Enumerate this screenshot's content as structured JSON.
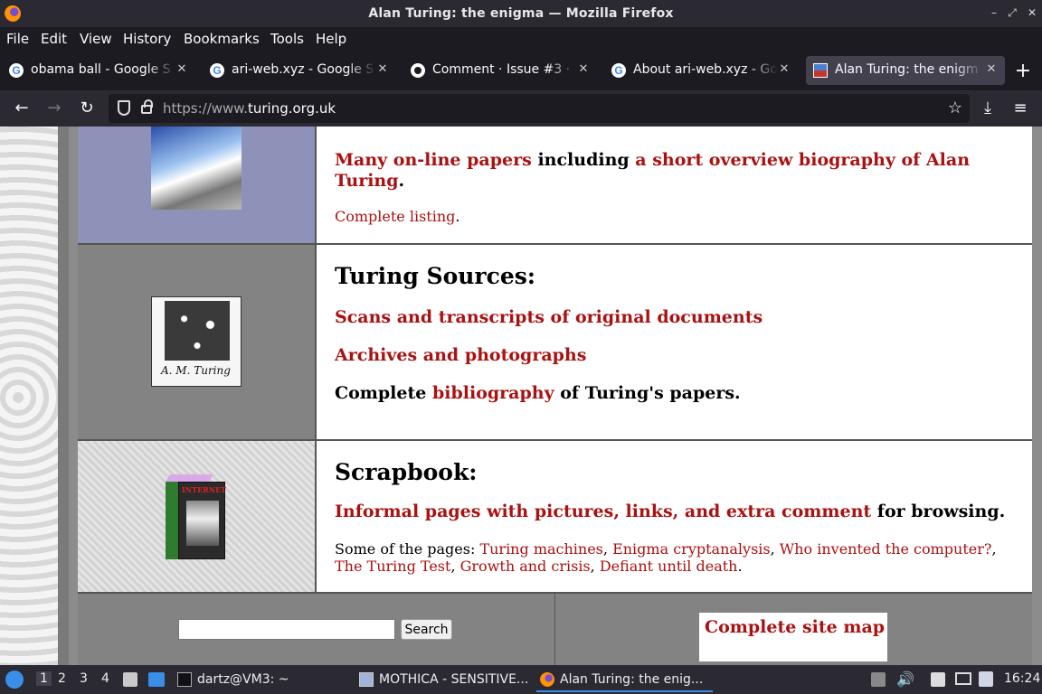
{
  "window": {
    "title": "Alan Turing: the enigma — Mozilla Firefox"
  },
  "menu": [
    "File",
    "Edit",
    "View",
    "History",
    "Bookmarks",
    "Tools",
    "Help"
  ],
  "tabs": [
    {
      "label": "obama ball - Google S",
      "icon": "google-icon"
    },
    {
      "label": "ari-web.xyz - Google S",
      "icon": "google-icon"
    },
    {
      "label": "Comment · Issue #3 ·",
      "icon": "github-icon"
    },
    {
      "label": "About ari-web.xyz - Go",
      "icon": "google-icon"
    },
    {
      "label": "Alan Turing: the enigm",
      "icon": "turing-site-icon",
      "active": true
    }
  ],
  "nav": {
    "url_prefix": "https://www.",
    "url_host": "turing.org.uk"
  },
  "page": {
    "papers": {
      "link1": "Many on-line papers",
      "text1": " including ",
      "link2": "a short overview biography of Alan Turing",
      "text2": ".",
      "complete_link": "Complete listing",
      "complete_text": "."
    },
    "sources": {
      "heading": "Turing Sources:",
      "link1": "Scans and transcripts of original documents",
      "link2": "Archives and photographs",
      "text_a": "Complete ",
      "link3": "bibliography",
      "text_b": " of Turing's papers."
    },
    "scrapbook": {
      "heading": "Scrapbook:",
      "link1": "Informal pages with pictures, links, and extra comment",
      "text1": " for browsing.",
      "intro": "Some of the pages: ",
      "links": [
        "Turing machines",
        "Enigma cryptanalysis",
        "Who invented the computer?",
        "The Turing Test",
        "Growth and crisis",
        "Defiant until death"
      ],
      "book_title": "INTERNET",
      "book_spine": "TURING",
      "book_sub": "SCRAPBOOK"
    },
    "footer": {
      "search_value": "",
      "search_button": "Search",
      "sitemap": "Complete site map"
    }
  },
  "taskbar": {
    "workspaces": [
      "1",
      "2",
      "3",
      "4"
    ],
    "apps": [
      {
        "label": "dartz@VM3: ~"
      },
      {
        "label": "MOTHICA - SENSITIVE..."
      },
      {
        "label": "Alan Turing: the enig...",
        "active": true
      }
    ],
    "clock": "16:24"
  }
}
